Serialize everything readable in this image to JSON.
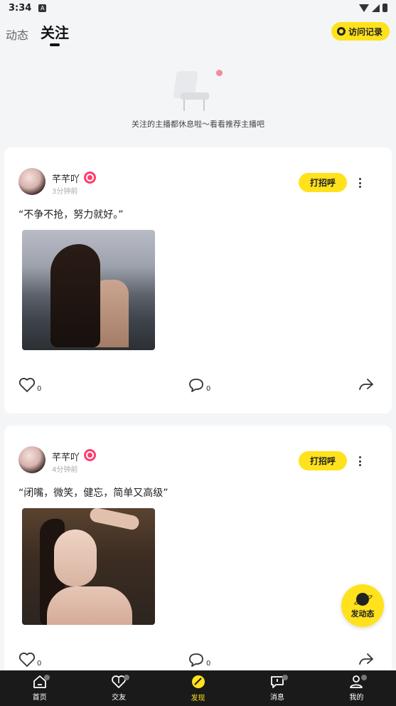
{
  "status": {
    "time": "3:34",
    "app_badge": "A"
  },
  "header": {
    "tab_dynamic": "动态",
    "tab_follow": "关注",
    "visit_button": "访问记录"
  },
  "empty_state": {
    "text": "关注的主播都休息啦～看看推荐主播吧"
  },
  "posts": [
    {
      "username": "芊芊吖",
      "time": "3分钟前",
      "text": "“不争不抢，努力就好。”",
      "greet": "打招呼",
      "likes": "0",
      "comments": "0"
    },
    {
      "username": "芊芊吖",
      "time": "4分钟前",
      "text": "“闭嘴，微笑，健忘，简单又高级”",
      "greet": "打招呼",
      "likes": "0",
      "comments": "0"
    }
  ],
  "fab": {
    "label": "发动态"
  },
  "tabbar": {
    "items": [
      {
        "label": "首页",
        "icon": "home-icon"
      },
      {
        "label": "交友",
        "icon": "heart-icon"
      },
      {
        "label": "发现",
        "icon": "discover-icon"
      },
      {
        "label": "消息",
        "icon": "message-icon"
      },
      {
        "label": "我的",
        "icon": "profile-icon"
      }
    ],
    "active": "发现"
  },
  "colors": {
    "accent": "#ffe21c",
    "badge": "#ff3d6e",
    "tabbar_bg": "#1a1a1a"
  }
}
